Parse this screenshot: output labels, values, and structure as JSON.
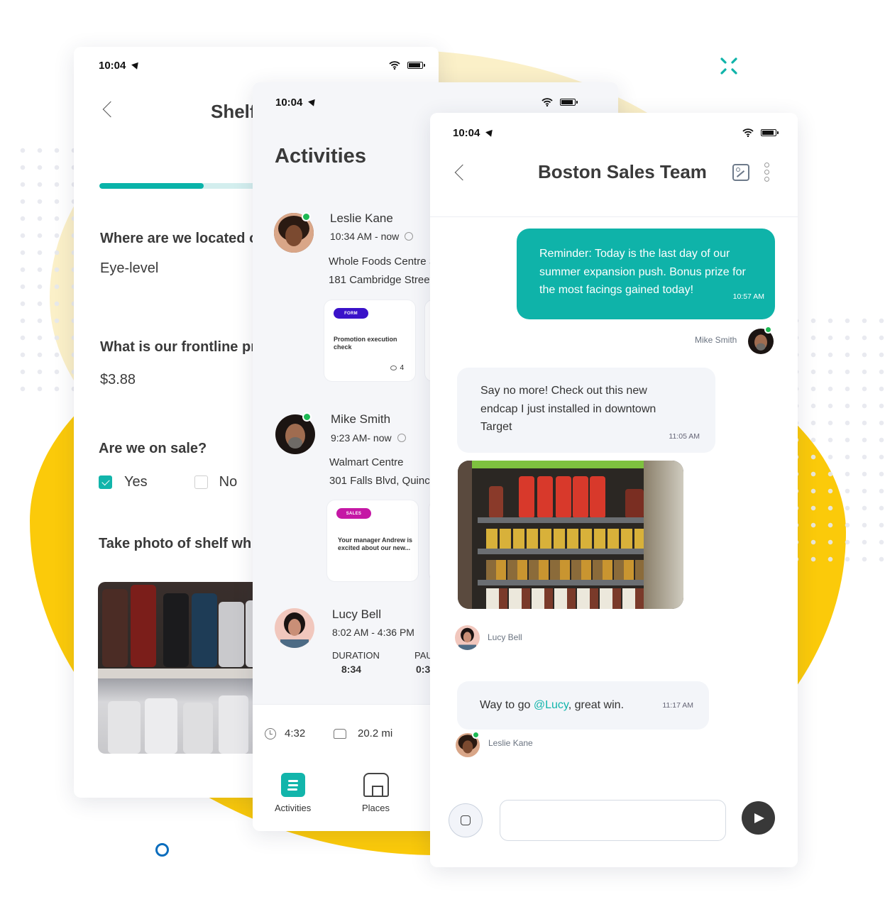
{
  "colors": {
    "accent": "#0fb3a9",
    "brand_yellow": "#fbca0a",
    "form_pill": "#3a12c9",
    "sales_pill": "#c517a5",
    "online": "#1db954",
    "mention": "#12b5ab"
  },
  "decor": {
    "sparkle_icon": "sparkle-icon",
    "ring_icon": "ring-icon"
  },
  "shelf_screen": {
    "status_time": "10:04",
    "title": "Shelf",
    "progress_fraction": 0.49,
    "questions": [
      {
        "label": "Where are we located o",
        "answer": "Eye-level"
      },
      {
        "label": "What is our frontline pri",
        "answer": "$3.88"
      },
      {
        "label": "Are we on sale?",
        "options": [
          {
            "label": "Yes",
            "checked": true
          },
          {
            "label": "No",
            "checked": false
          }
        ]
      },
      {
        "label": "Take photo of shelf wh"
      }
    ]
  },
  "activities_screen": {
    "status_time": "10:04",
    "title": "Activities",
    "items": [
      {
        "name": "Leslie Kane",
        "time": "10:34 AM - now",
        "online": true,
        "place": "Whole Foods Centre St",
        "address": "181 Cambridge Street,",
        "card": {
          "tag": "FORM",
          "text": "Promotion execution check",
          "comments": "4"
        }
      },
      {
        "name": "Mike Smith",
        "time": "9:23 AM- now",
        "online": true,
        "place": "Walmart Centre",
        "address": "301 Falls Blvd, Quincy,",
        "card": {
          "tag": "SALES",
          "text": "Your manager Andrew is excited about our new..."
        }
      },
      {
        "name": "Lucy Bell",
        "time": "8:02 AM - 4:36 PM",
        "online": false,
        "stats": [
          {
            "label": "DURATION",
            "value": "8:34"
          },
          {
            "label": "PAU",
            "value": "0:3"
          }
        ]
      }
    ],
    "summary": {
      "time": "4:32",
      "distance": "20.2 mi"
    },
    "tabs": [
      {
        "label": "Activities",
        "active": true
      },
      {
        "label": "Places",
        "active": false
      }
    ]
  },
  "chat_screen": {
    "status_time": "10:04",
    "title": "Boston Sales Team",
    "messages": [
      {
        "direction": "out",
        "text": "Reminder: Today is the last day of our summer expansion push. Bonus prize for the most facings gained today!",
        "time": "10:57 AM",
        "sender": "Mike Smith",
        "online": true
      },
      {
        "direction": "in",
        "text": "Say no more! Check out this new endcap I just installed in downtown Target",
        "time": "11:05 AM",
        "sender": "Lucy Bell",
        "has_photo": true
      },
      {
        "direction": "in",
        "text_before": "Way to go ",
        "mention": "@Lucy",
        "text_after": ", great win.",
        "time": "11:17 AM",
        "sender": "Leslie Kane",
        "online": true
      }
    ],
    "composer": {
      "value": "",
      "placeholder": ""
    }
  }
}
